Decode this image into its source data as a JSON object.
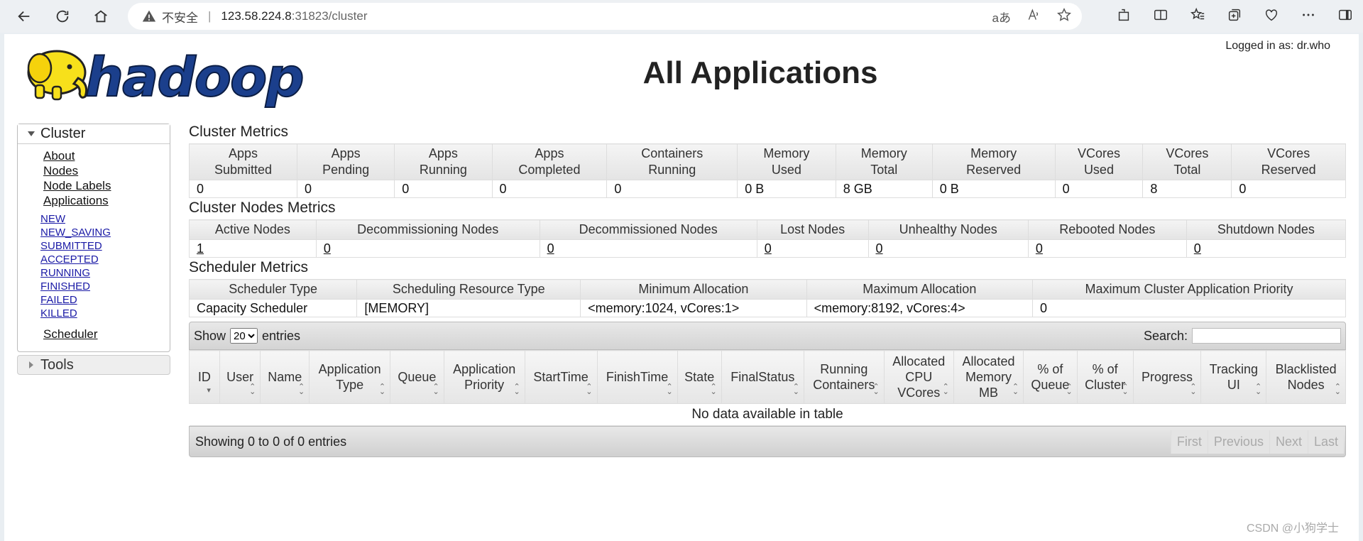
{
  "browser": {
    "insecure_label": "不安全",
    "url_host": "123.58.224.8",
    "url_rest": ":31823/cluster",
    "url_tool_translate": "aあ",
    "url_tool_read": "Á"
  },
  "header": {
    "title": "All Applications",
    "login_info": "Logged in as: dr.who",
    "logo_text": "hadoop"
  },
  "sidebar": {
    "cluster_label": "Cluster",
    "links": [
      "About",
      "Nodes",
      "Node Labels",
      "Applications"
    ],
    "app_states": [
      "NEW",
      "NEW_SAVING",
      "SUBMITTED",
      "ACCEPTED",
      "RUNNING",
      "FINISHED",
      "FAILED",
      "KILLED"
    ],
    "scheduler": "Scheduler",
    "tools_label": "Tools"
  },
  "cluster_metrics": {
    "title": "Cluster Metrics",
    "headers": [
      [
        "Apps",
        "Submitted"
      ],
      [
        "Apps",
        "Pending"
      ],
      [
        "Apps",
        "Running"
      ],
      [
        "Apps",
        "Completed"
      ],
      [
        "Containers",
        "Running"
      ],
      [
        "Memory",
        "Used"
      ],
      [
        "Memory",
        "Total"
      ],
      [
        "Memory",
        "Reserved"
      ],
      [
        "VCores",
        "Used"
      ],
      [
        "VCores",
        "Total"
      ],
      [
        "VCores",
        "Reserved"
      ]
    ],
    "values": [
      "0",
      "0",
      "0",
      "0",
      "0",
      "0 B",
      "8 GB",
      "0 B",
      "0",
      "8",
      "0"
    ]
  },
  "node_metrics": {
    "title": "Cluster Nodes Metrics",
    "headers": [
      "Active Nodes",
      "Decommissioning Nodes",
      "Decommissioned Nodes",
      "Lost Nodes",
      "Unhealthy Nodes",
      "Rebooted Nodes",
      "Shutdown Nodes"
    ],
    "values": [
      "1",
      "0",
      "0",
      "0",
      "0",
      "0",
      "0"
    ]
  },
  "scheduler_metrics": {
    "title": "Scheduler Metrics",
    "headers": [
      "Scheduler Type",
      "Scheduling Resource Type",
      "Minimum Allocation",
      "Maximum Allocation",
      "Maximum Cluster Application Priority"
    ],
    "values": [
      "Capacity Scheduler",
      "[MEMORY]",
      "<memory:1024, vCores:1>",
      "<memory:8192, vCores:4>",
      "0"
    ]
  },
  "apps_table": {
    "show_label": "Show",
    "entries_value": "20",
    "entries_label": "entries",
    "search_label": "Search:",
    "columns": [
      [
        "ID"
      ],
      [
        "User"
      ],
      [
        "Name"
      ],
      [
        "Application",
        "Type"
      ],
      [
        "Queue"
      ],
      [
        "Application",
        "Priority"
      ],
      [
        "StartTime"
      ],
      [
        "FinishTime"
      ],
      [
        "State"
      ],
      [
        "FinalStatus"
      ],
      [
        "Running",
        "Containers"
      ],
      [
        "Allocated",
        "CPU",
        "VCores"
      ],
      [
        "Allocated",
        "Memory",
        "MB"
      ],
      [
        "% of",
        "Queue"
      ],
      [
        "% of",
        "Cluster"
      ],
      [
        "Progress"
      ],
      [
        "Tracking",
        "UI"
      ],
      [
        "Blacklisted",
        "Nodes"
      ]
    ],
    "empty_text": "No data available in table",
    "footer_info": "Showing 0 to 0 of 0 entries",
    "pager": [
      "First",
      "Previous",
      "Next",
      "Last"
    ]
  },
  "watermark": "CSDN @小狗学士"
}
